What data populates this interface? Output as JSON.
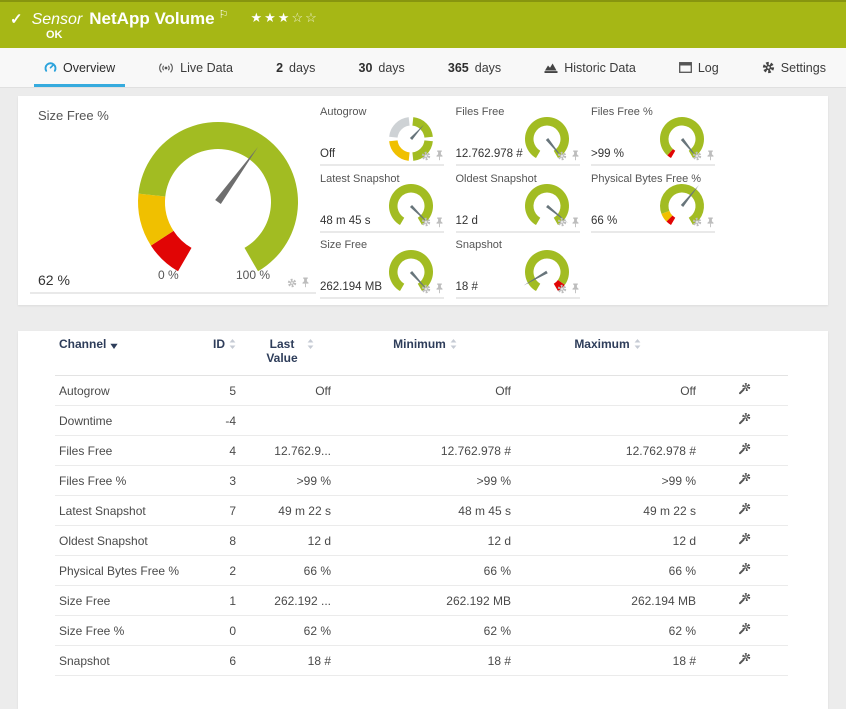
{
  "header": {
    "checkmark": "✓",
    "kind": "Sensor",
    "title": "NetApp Volume",
    "flag": "⚐",
    "status": "OK",
    "stars": {
      "filled": 3,
      "total": 5,
      "filled_glyph": "★",
      "empty_glyph": "☆"
    }
  },
  "colors": {
    "brand_green": "#a6b715",
    "gauge_green": "#a2bc22",
    "gauge_yellow": "#f0c000",
    "gauge_red": "#e10505",
    "segment_gray": "#ced2d5",
    "accent_blue": "#36abde",
    "header_text_navy": "#2e3d5a"
  },
  "tabs": [
    {
      "id": "overview",
      "label": "Overview",
      "icon": "gauge-icon",
      "active": true
    },
    {
      "id": "live-data",
      "label": "Live Data",
      "icon": "broadcast-icon",
      "active": false
    },
    {
      "id": "2-days",
      "prefix": "2",
      "label": "days",
      "active": false
    },
    {
      "id": "30-days",
      "prefix": "30",
      "label": "days",
      "active": false
    },
    {
      "id": "365-days",
      "prefix": "365",
      "label": "days",
      "active": false
    },
    {
      "id": "historic-data",
      "label": "Historic Data",
      "icon": "area-chart-icon",
      "active": false
    },
    {
      "id": "log",
      "label": "Log",
      "icon": "log-icon",
      "active": false
    },
    {
      "id": "settings",
      "label": "Settings",
      "icon": "gear-icon",
      "active": false
    }
  ],
  "gauges": {
    "main": {
      "label": "Size Free %",
      "value": "62 %",
      "min_label": "0 %",
      "max_label": "100 %",
      "needle_pct": 62,
      "segments": [
        {
          "from": 0,
          "to": 9,
          "color": "#e10505"
        },
        {
          "from": 9,
          "to": 22,
          "color": "#f0c000"
        },
        {
          "from": 22,
          "to": 100,
          "color": "#a2bc22"
        }
      ]
    },
    "small": [
      {
        "label": "Autogrow",
        "value": "Off",
        "type": "ring4",
        "needle_angle": 42,
        "segments_deg": [
          [
            6,
            84,
            "#a2bc22"
          ],
          [
            96,
            174,
            "#a2bc22"
          ],
          [
            186,
            264,
            "#f0c000"
          ],
          [
            276,
            354,
            "#ced2d5"
          ]
        ]
      },
      {
        "label": "Files Free",
        "value": "12.762.978 #",
        "needle_pct": 97,
        "segments": [
          {
            "from": 0,
            "to": 100,
            "color": "#a2bc22"
          }
        ]
      },
      {
        "label": "Files Free %",
        "value": ">99 %",
        "needle_pct": 97,
        "segments": [
          {
            "from": 0,
            "to": 4,
            "color": "#e10505"
          },
          {
            "from": 4,
            "to": 100,
            "color": "#a2bc22"
          }
        ]
      },
      {
        "label": "Latest Snapshot",
        "value": "48 m 45 s",
        "needle_pct": 95,
        "segments": [
          {
            "from": 0,
            "to": 100,
            "color": "#a2bc22"
          }
        ]
      },
      {
        "label": "Oldest Snapshot",
        "value": "12 d",
        "needle_pct": 93,
        "segments": [
          {
            "from": 0,
            "to": 100,
            "color": "#a2bc22"
          }
        ]
      },
      {
        "label": "Physical Bytes Free %",
        "value": "66 %",
        "needle_pct": 63,
        "segments": [
          {
            "from": 0,
            "to": 5,
            "color": "#e10505"
          },
          {
            "from": 5,
            "to": 13,
            "color": "#f0c000"
          },
          {
            "from": 13,
            "to": 100,
            "color": "#a2bc22"
          }
        ]
      },
      {
        "label": "Size Free",
        "value": "262.194 MB",
        "needle_pct": 96,
        "segments": [
          {
            "from": 0,
            "to": 100,
            "color": "#a2bc22"
          }
        ]
      },
      {
        "label": "Snapshot",
        "value": "18 #",
        "needle_pct": 10,
        "segments": [
          {
            "from": 0,
            "to": 92,
            "color": "#a2bc22"
          },
          {
            "from": 92,
            "to": 100,
            "color": "#e10505"
          }
        ]
      }
    ]
  },
  "table": {
    "columns": [
      {
        "label": "Channel",
        "sort": "desc"
      },
      {
        "label": "ID",
        "sort": "both"
      },
      {
        "label": "Last Value",
        "sort": "both"
      },
      {
        "label": "Minimum",
        "sort": "both"
      },
      {
        "label": "Maximum",
        "sort": "both"
      }
    ],
    "rows": [
      {
        "channel": "Autogrow",
        "id": "5",
        "last": "Off",
        "min": "Off",
        "max": "Off"
      },
      {
        "channel": "Downtime",
        "id": "-4",
        "last": "",
        "min": "",
        "max": ""
      },
      {
        "channel": "Files Free",
        "id": "4",
        "last": "12.762.9...",
        "min": "12.762.978 #",
        "max": "12.762.978 #"
      },
      {
        "channel": "Files Free %",
        "id": "3",
        "last": ">99 %",
        "min": ">99 %",
        "max": ">99 %"
      },
      {
        "channel": "Latest Snapshot",
        "id": "7",
        "last": "49 m 22 s",
        "min": "48 m 45 s",
        "max": "49 m 22 s"
      },
      {
        "channel": "Oldest Snapshot",
        "id": "8",
        "last": "12 d",
        "min": "12 d",
        "max": "12 d"
      },
      {
        "channel": "Physical Bytes Free %",
        "id": "2",
        "last": "66 %",
        "min": "66 %",
        "max": "66 %"
      },
      {
        "channel": "Size Free",
        "id": "1",
        "last": "262.192 ...",
        "min": "262.192 MB",
        "max": "262.194 MB"
      },
      {
        "channel": "Size Free %",
        "id": "0",
        "last": "62 %",
        "min": "62 %",
        "max": "62 %"
      },
      {
        "channel": "Snapshot",
        "id": "6",
        "last": "18 #",
        "min": "18 #",
        "max": "18 #"
      }
    ]
  }
}
